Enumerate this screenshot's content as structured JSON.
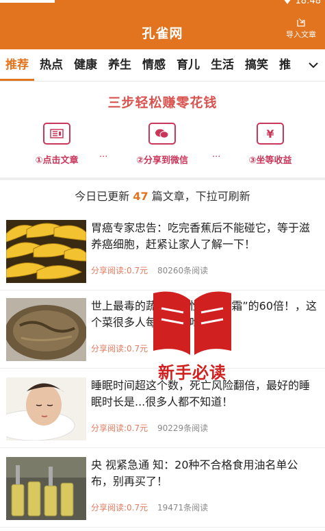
{
  "status": {
    "time": "18:48"
  },
  "header": {
    "title": "孔雀网",
    "import_label": "导入文章"
  },
  "tabs": [
    "推荐",
    "热点",
    "健康",
    "养生",
    "情感",
    "育儿",
    "生活",
    "搞笑",
    "推"
  ],
  "promo": {
    "title": "三步轻松赚零花钱",
    "steps": [
      {
        "icon": "article-icon",
        "label": "①点击文章"
      },
      {
        "icon": "wechat-icon",
        "label": "②分享到微信"
      },
      {
        "icon": "yen-icon",
        "label": "③坐等收益"
      }
    ],
    "separator": "···"
  },
  "notice": {
    "prefix": "今日已更新 ",
    "count": "47",
    "suffix": " 篇文章，下拉可刷新"
  },
  "articles": [
    {
      "title": "胃癌专家忠告：吃完香蕉后不能碰它，等于滋养癌细胞，赶紧让家人了解一下！",
      "reward": "分享阅读:0.7元",
      "reads": "80260条阅读"
    },
    {
      "title": "世上最毒的蔬菜，毒性是“砒.霜”的60倍！，这个菜很多人每天都在吃！",
      "reward": "分享阅读:0.7元",
      "reads": ""
    },
    {
      "title": "睡眠时间超这个数，死亡风险翻倍，最好的睡眠时长是...很多人都不知道！",
      "reward": "分享阅读:0.7元",
      "reads": "90229条阅读"
    },
    {
      "title": "央 视紧急通 知：20种不合格食用油名单公布，别再买了！",
      "reward": "分享阅读:0.7元",
      "reads": "19471条阅读"
    }
  ],
  "badge": {
    "text": "新手必读"
  },
  "colors": {
    "brand": "#e2741f",
    "promo": "#c9365a",
    "badge": "#d02020"
  }
}
